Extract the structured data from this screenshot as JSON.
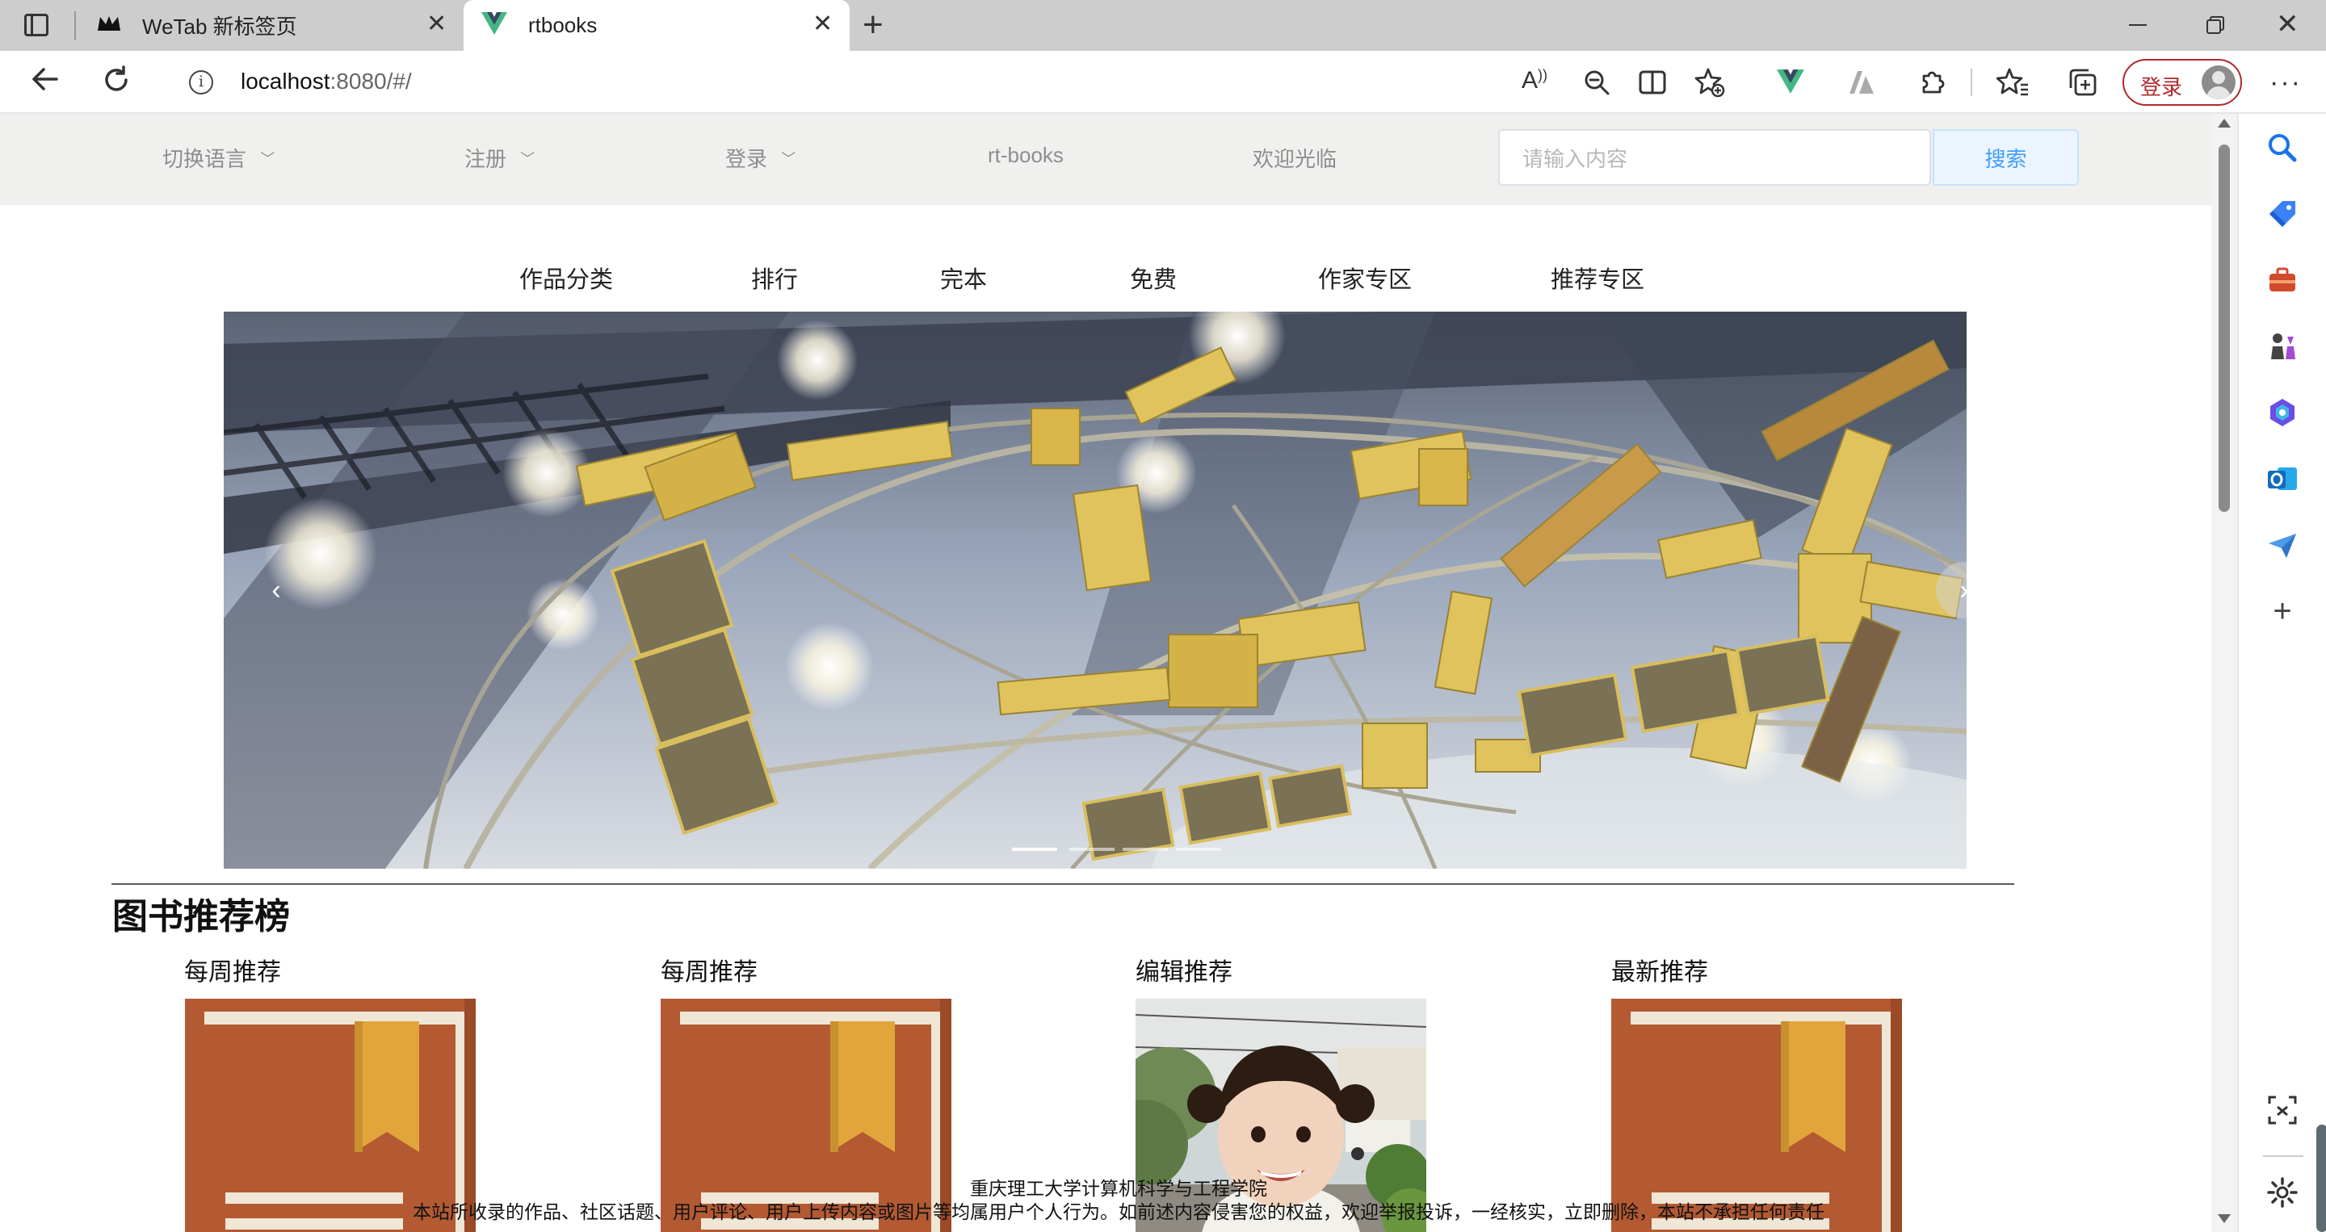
{
  "browser": {
    "tabs": [
      {
        "title": "WeTab 新标签页"
      },
      {
        "title": "rtbooks"
      }
    ],
    "url_host": "localhost",
    "url_rest": ":8080/#/",
    "profile_login_label": "登录"
  },
  "site_nav": {
    "language_label": "切换语言",
    "register_label": "注册",
    "login_label": "登录",
    "brand": "rt-books",
    "welcome": "欢迎光临",
    "search_placeholder": "请输入内容",
    "search_button": "搜索"
  },
  "categories": [
    "作品分类",
    "排行",
    "完本",
    "免费",
    "作家专区",
    "推荐专区"
  ],
  "carousel": {
    "prev_symbol": "‹",
    "next_symbol": "›",
    "active_index": 0,
    "count": 4
  },
  "recommend": {
    "title": "图书推荐榜",
    "cards": [
      {
        "label": "每周推荐",
        "image": "book-icon"
      },
      {
        "label": "每周推荐",
        "image": "book-icon"
      },
      {
        "label": "编辑推荐",
        "image": "child-photo"
      },
      {
        "label": "最新推荐",
        "image": "book-icon"
      }
    ]
  },
  "footer": {
    "line1": "重庆理工大学计算机科学与工程学院",
    "line2": "本站所收录的作品、社区话题、用户评论、用户上传内容或图片等均属用户个人行为。如前述内容侵害您的权益，欢迎举报投诉，一经核实，立即删除，本站不承担任何责任"
  },
  "colors": {
    "accent": "#409eff",
    "book_cover": "#b35a33",
    "book_ribbon": "#e2a53b",
    "nav_bg": "#f0f0ee"
  }
}
